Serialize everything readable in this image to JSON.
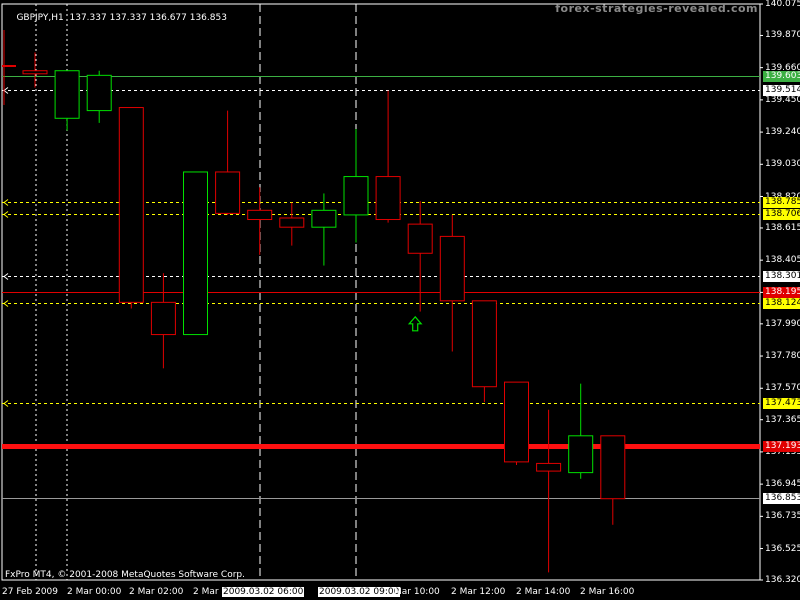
{
  "header": {
    "symbol": "GBPJPY,H1",
    "ohlc": "137.337 137.337 136.677 136.853"
  },
  "watermark": "forex-strategies-revealed.com",
  "copyright": "FxPro MT4, © 2001-2008 MetaQuotes Software Corp.",
  "colors": {
    "background": "#000000",
    "bull": "#00e000",
    "bear": "#e00000",
    "level_yellow": "#ffff00",
    "level_white": "#ffffff",
    "grid": "#ffffff"
  },
  "chart_data": {
    "type": "candlestick",
    "ylim": [
      136.32,
      140.075
    ],
    "y_ticks": [
      "140.075",
      "139.870",
      "139.660",
      "139.450",
      "139.240",
      "139.030",
      "138.820",
      "138.615",
      "138.405",
      "138.195",
      "137.990",
      "137.780",
      "137.570",
      "137.365",
      "137.155",
      "136.945",
      "136.735",
      "136.525",
      "136.320"
    ],
    "x_ticks": [
      "27 Feb 2009",
      "2 Mar 00:00",
      "2 Mar 02:00",
      "2 Mar",
      "2009.03.02 06:00",
      "2009.03.02 09:00",
      "Mar 10:00",
      "2 Mar 12:00",
      "2 Mar 14:00",
      "2 Mar 16:00"
    ],
    "candles": [
      {
        "o": 139.64,
        "h": 139.76,
        "l": 139.53,
        "c": 139.62
      },
      {
        "o": 139.33,
        "h": 139.64,
        "l": 139.25,
        "c": 139.64
      },
      {
        "o": 139.38,
        "h": 139.64,
        "l": 139.3,
        "c": 139.61
      },
      {
        "o": 139.4,
        "h": 139.4,
        "l": 138.09,
        "c": 138.13
      },
      {
        "o": 138.13,
        "h": 138.32,
        "l": 137.7,
        "c": 137.92
      },
      {
        "o": 137.92,
        "h": 138.98,
        "l": 137.92,
        "c": 138.98
      },
      {
        "o": 138.98,
        "h": 139.38,
        "l": 138.7,
        "c": 138.71
      },
      {
        "o": 138.73,
        "h": 138.88,
        "l": 138.44,
        "c": 138.67
      },
      {
        "o": 138.68,
        "h": 138.78,
        "l": 138.5,
        "c": 138.62
      },
      {
        "o": 138.62,
        "h": 138.84,
        "l": 138.37,
        "c": 138.73
      },
      {
        "o": 138.7,
        "h": 139.26,
        "l": 138.52,
        "c": 138.95
      },
      {
        "o": 138.95,
        "h": 139.51,
        "l": 138.65,
        "c": 138.67
      },
      {
        "o": 138.64,
        "h": 138.79,
        "l": 138.07,
        "c": 138.45
      },
      {
        "o": 138.56,
        "h": 138.7,
        "l": 137.81,
        "c": 138.14
      },
      {
        "o": 138.14,
        "h": 138.14,
        "l": 137.48,
        "c": 137.58
      },
      {
        "o": 137.61,
        "h": 137.57,
        "l": 137.07,
        "c": 137.09
      },
      {
        "o": 137.08,
        "h": 137.43,
        "l": 136.37,
        "c": 137.03
      },
      {
        "o": 137.02,
        "h": 137.6,
        "l": 136.98,
        "c": 137.26
      },
      {
        "o": 137.26,
        "h": 137.26,
        "l": 136.68,
        "c": 136.85
      }
    ],
    "levels": [
      {
        "price": 139.603,
        "label": "139.603",
        "style": "solid-green",
        "tag": "green"
      },
      {
        "price": 139.514,
        "label": "139.514",
        "style": "dash-white",
        "tag": "white"
      },
      {
        "price": 138.785,
        "label": "138.785",
        "style": "dash-yellow",
        "tag": "yellow"
      },
      {
        "price": 138.706,
        "label": "138.706",
        "style": "dash-yellow",
        "tag": "yellow"
      },
      {
        "price": 138.301,
        "label": "138.301",
        "style": "dash-white",
        "tag": "white"
      },
      {
        "price": 138.195,
        "label": "138.195",
        "style": "solid-red",
        "tag": "red"
      },
      {
        "price": 138.124,
        "label": "138.124",
        "style": "dash-yellow",
        "tag": "yellow"
      },
      {
        "price": 137.473,
        "label": "137.473",
        "style": "dash-yellow",
        "tag": "yellow"
      },
      {
        "price": 137.193,
        "label": "137.193",
        "style": "thick-red",
        "tag": "red"
      },
      {
        "price": 136.853,
        "label": "136.853",
        "style": "solid-gray",
        "tag": "white"
      }
    ],
    "grid": true,
    "arrow_marker": {
      "candle_index": 12,
      "price": 137.99,
      "direction": "up"
    }
  }
}
